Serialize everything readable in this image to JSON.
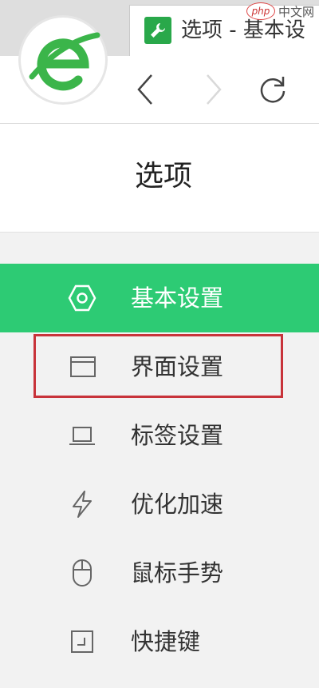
{
  "browser": {
    "tab_title": "选项 - 基本设",
    "favicon": "wrench-icon"
  },
  "watermark": {
    "oval_text": "php",
    "text": "中文网"
  },
  "toolbar": {
    "back": "chevron-left-icon",
    "forward": "chevron-right-icon",
    "refresh": "refresh-icon"
  },
  "options": {
    "title": "选项"
  },
  "menu": {
    "items": [
      {
        "label": "基本设置",
        "icon": "hexagon-gear-icon",
        "active": true
      },
      {
        "label": "界面设置",
        "icon": "window-icon",
        "active": false,
        "highlighted": true
      },
      {
        "label": "标签设置",
        "icon": "laptop-icon",
        "active": false
      },
      {
        "label": "优化加速",
        "icon": "lightning-icon",
        "active": false
      },
      {
        "label": "鼠标手势",
        "icon": "mouse-icon",
        "active": false
      },
      {
        "label": "快捷键",
        "icon": "keyboard-icon",
        "active": false
      }
    ]
  },
  "colors": {
    "accent": "#2dcb74",
    "highlight_border": "#c8333a",
    "logo_green": "#3bb54a"
  }
}
